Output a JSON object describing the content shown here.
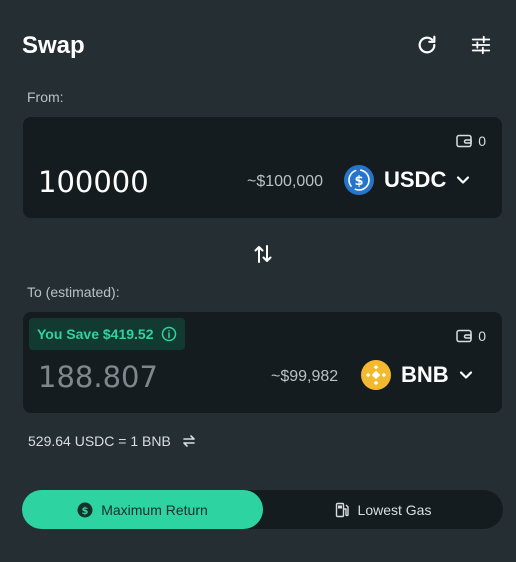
{
  "header": {
    "title": "Swap",
    "refresh_icon": "refresh-icon",
    "settings_icon": "sliders-icon"
  },
  "from": {
    "label": "From:",
    "balance": "0",
    "amount": "100000",
    "usd_value": "~$100,000",
    "token": {
      "symbol": "USDC",
      "icon": "usdc-logo",
      "color": "#2775ca"
    }
  },
  "to": {
    "label": "To (estimated):",
    "savings": "You Save $419.52",
    "balance": "0",
    "amount": "188.807",
    "usd_value": "~$99,982",
    "token": {
      "symbol": "BNB",
      "icon": "bnb-logo",
      "color": "#f3ba2f"
    }
  },
  "rate": {
    "text": "529.64 USDC = 1 BNB"
  },
  "route": {
    "options": [
      {
        "label": "Maximum Return",
        "icon": "dollar-coin-icon",
        "selected": true
      },
      {
        "label": "Lowest Gas",
        "icon": "fuel-pump-icon",
        "selected": false
      }
    ]
  },
  "colors": {
    "background": "#252f33",
    "card": "#151c1f",
    "accent": "#2dd4a1",
    "savings_bg": "#133a30"
  }
}
